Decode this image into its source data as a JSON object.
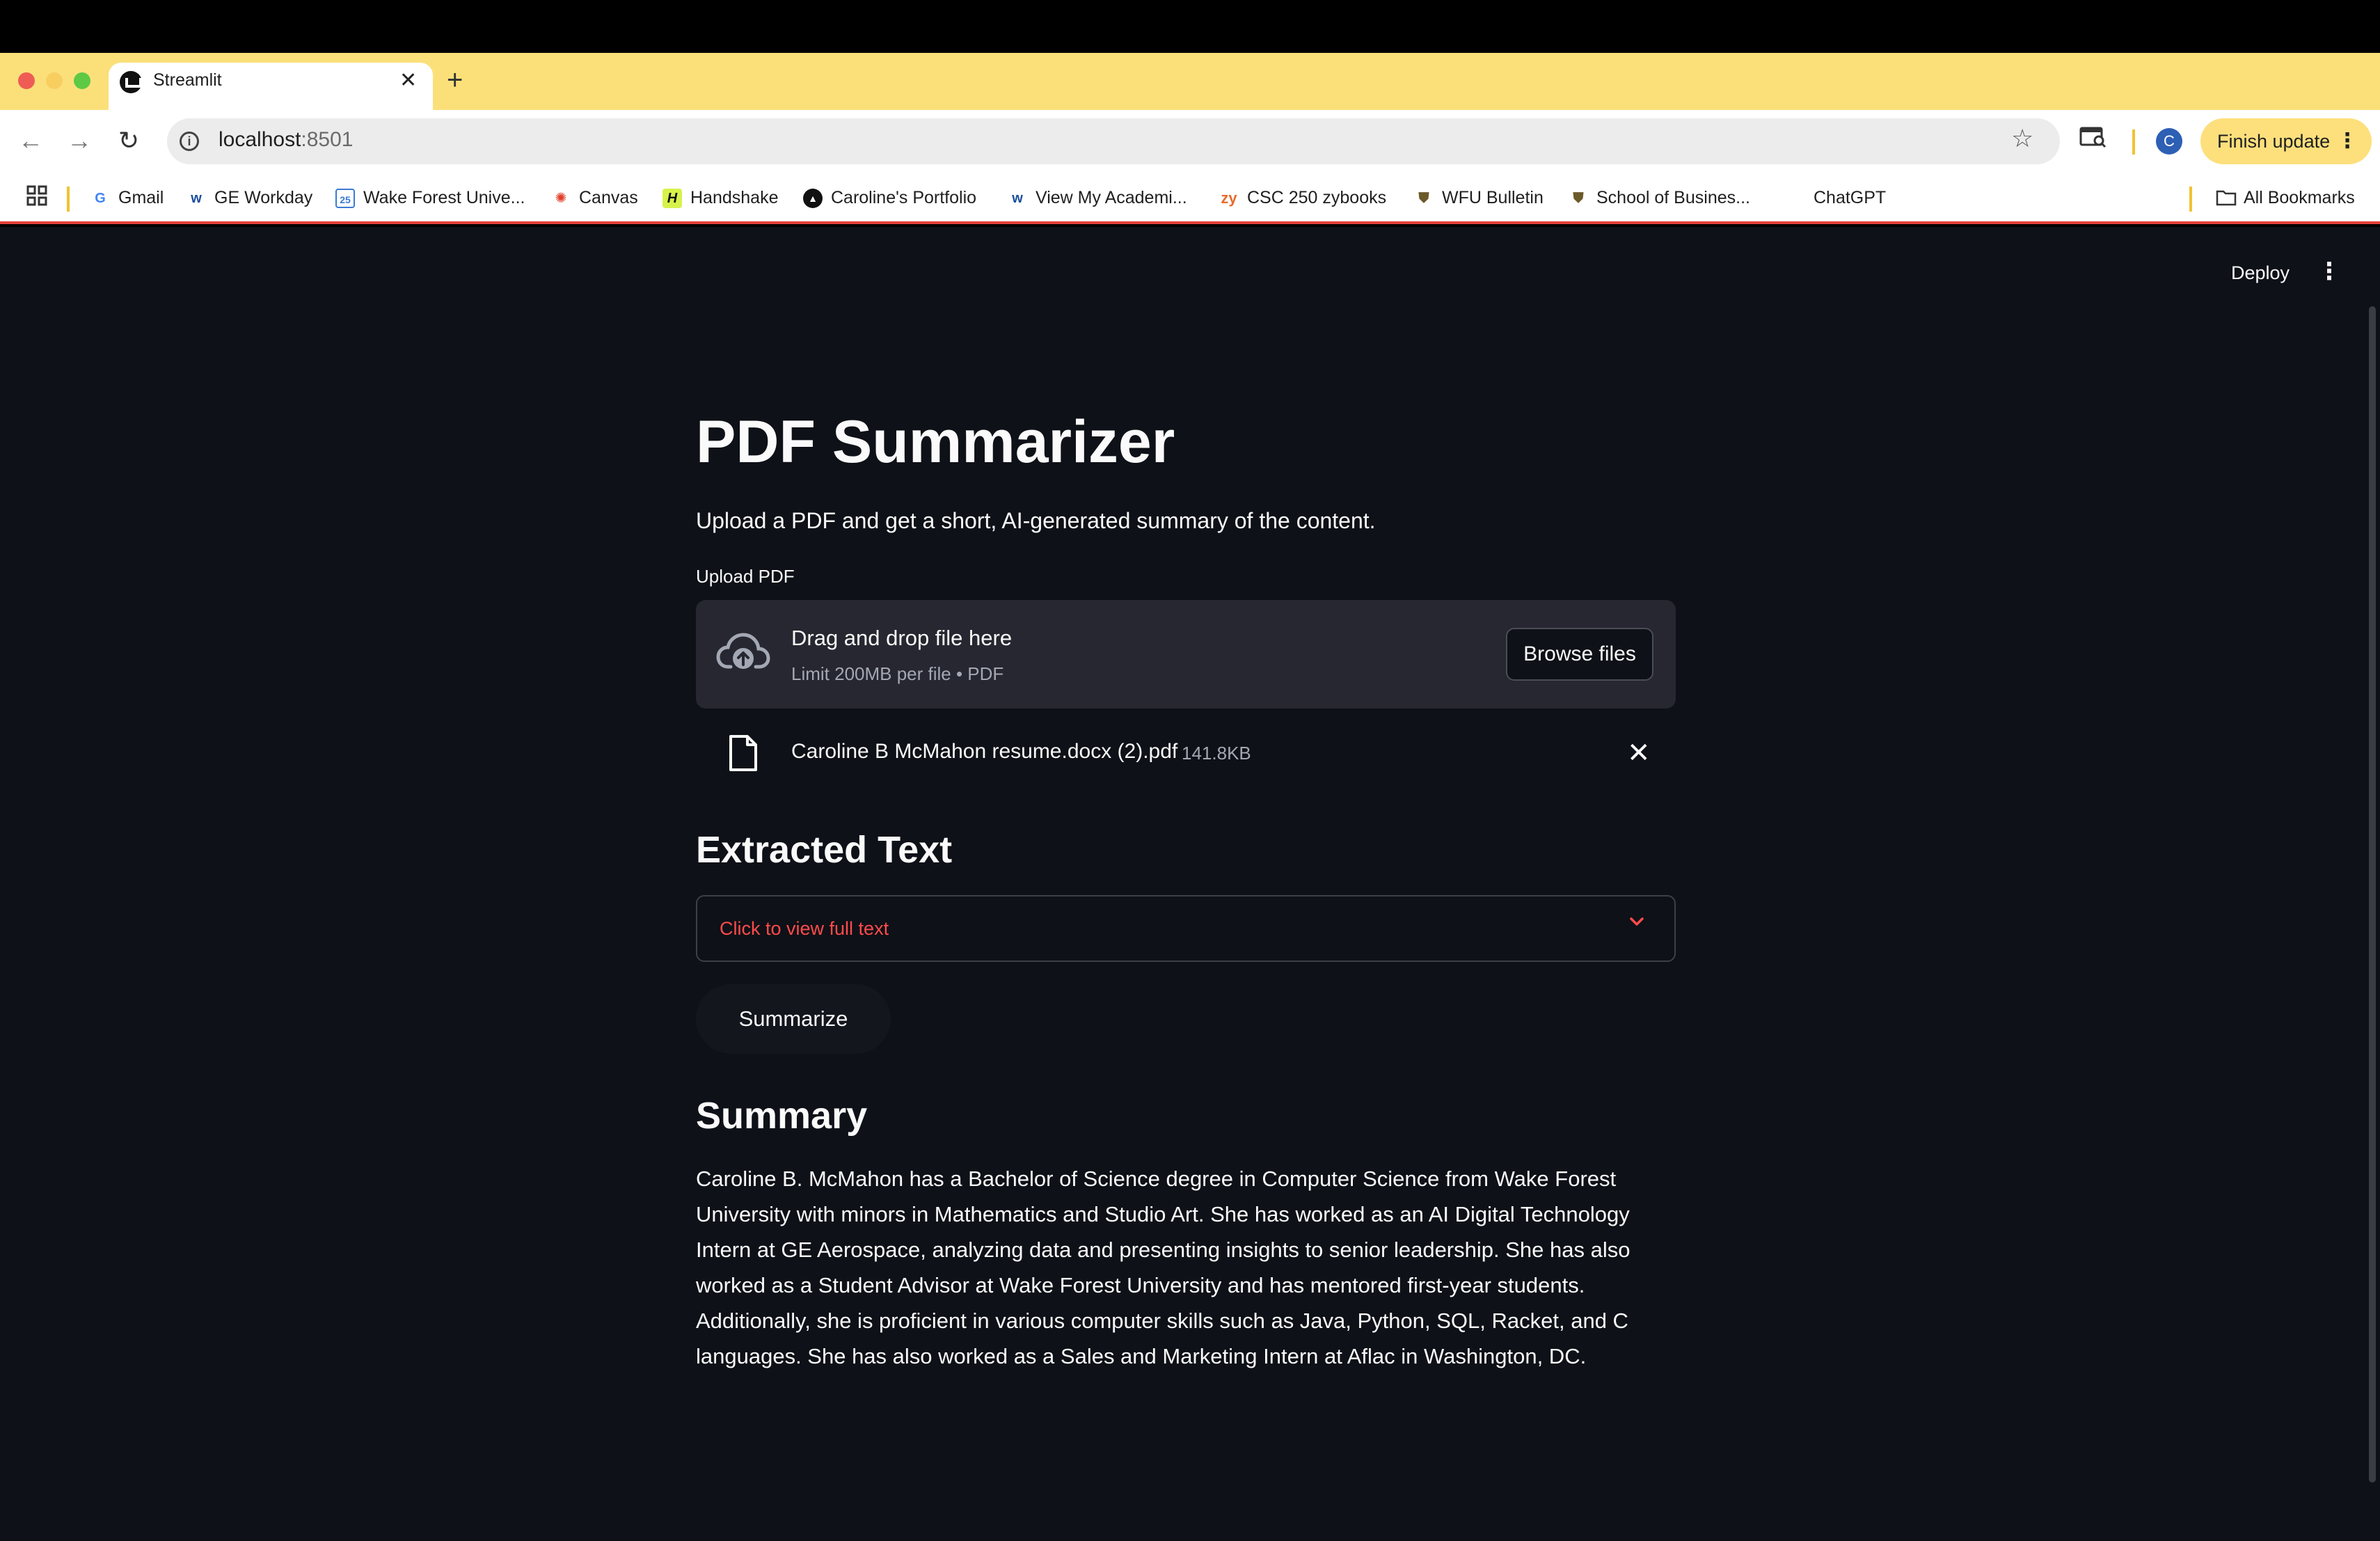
{
  "browser": {
    "tab_title": "Streamlit",
    "url_host": "localhost",
    "url_port": ":8501",
    "finish_update_label": "Finish update",
    "profile_initial": "C",
    "bookmarks": [
      {
        "label": "Gmail",
        "icon": "google-icon"
      },
      {
        "label": "GE Workday",
        "icon": "workday-icon"
      },
      {
        "label": "Wake Forest Unive...",
        "icon": "calendar-icon"
      },
      {
        "label": "Canvas",
        "icon": "canvas-icon"
      },
      {
        "label": "Handshake",
        "icon": "handshake-icon"
      },
      {
        "label": "Caroline's Portfolio",
        "icon": "portfolio-icon"
      },
      {
        "label": "View My Academi...",
        "icon": "workday-icon"
      },
      {
        "label": "CSC 250 zybooks",
        "icon": "zybooks-icon"
      },
      {
        "label": "WFU Bulletin",
        "icon": "shield-icon"
      },
      {
        "label": "School of Busines...",
        "icon": "shield-icon"
      },
      {
        "label": "ChatGPT",
        "icon": ""
      }
    ],
    "all_bookmarks_label": "All Bookmarks"
  },
  "app": {
    "deploy_label": "Deploy",
    "title": "PDF Summarizer",
    "subtitle": "Upload a PDF and get a short, AI-generated summary of the content.",
    "uploader": {
      "label": "Upload PDF",
      "drop_title": "Drag and drop file here",
      "limit_text": "Limit 200MB per file • PDF",
      "browse_label": "Browse files",
      "file_name": "Caroline B McMahon resume.docx (2).pdf",
      "file_size": "141.8KB"
    },
    "extracted_heading": "Extracted Text",
    "expander_label": "Click to view full text",
    "summarize_label": "Summarize",
    "summary_heading": "Summary",
    "summary_text": "Caroline B. McMahon has a Bachelor of Science degree in Computer Science from Wake Forest University with minors in Mathematics and Studio Art. She has worked as an AI Digital Technology Intern at GE Aerospace, analyzing data and presenting insights to senior leadership. She has also worked as a Student Advisor at Wake Forest University and has mentored first-year students. Additionally, she is proficient in various computer skills such as Java, Python, SQL, Racket, and C languages. She has also worked as a Sales and Marketing Intern at Aflac in Washington, DC."
  },
  "colors": {
    "app_bg": "#0e1117",
    "accent_red": "#ff4b4b",
    "tabstrip": "#fbe07a"
  }
}
